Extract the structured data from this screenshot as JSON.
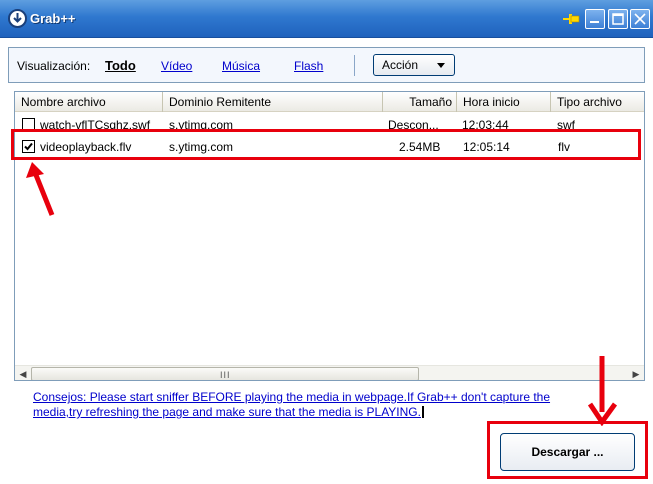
{
  "window": {
    "title": "Grab++",
    "accent_color": "#2f78cf",
    "icons": [
      "grab-logo-icon",
      "pin-icon",
      "minimize-icon",
      "maximize-icon",
      "close-icon"
    ]
  },
  "toolbar": {
    "view_label": "Visualización:",
    "filters": [
      "Todo",
      "Vídeo",
      "Música",
      "Flash"
    ],
    "active_filter": "Todo",
    "action_label": "Acción"
  },
  "columns": [
    "Nombre archivo",
    "Dominio Remitente",
    "Tamaño",
    "Hora inicio",
    "Tipo archivo"
  ],
  "files": [
    {
      "checked": false,
      "name": "watch-vflTCsqhz.swf",
      "domain": "s.ytimg.com",
      "size": "Descon...",
      "start": "12:03:44",
      "type": "swf"
    },
    {
      "checked": true,
      "name": "videoplayback.flv",
      "domain": "s.ytimg.com",
      "size": "2.54MB",
      "start": "12:05:14",
      "type": "flv"
    }
  ],
  "scrollbar": {
    "grip": "III"
  },
  "tips": {
    "text": "Consejos: Please start sniffer BEFORE playing the media in webpage.If Grab++ don't capture the media,try refreshing the page and make sure that the media is PLAYING."
  },
  "download": {
    "label": "Descargar ..."
  },
  "annotation_color": "#e8000d"
}
